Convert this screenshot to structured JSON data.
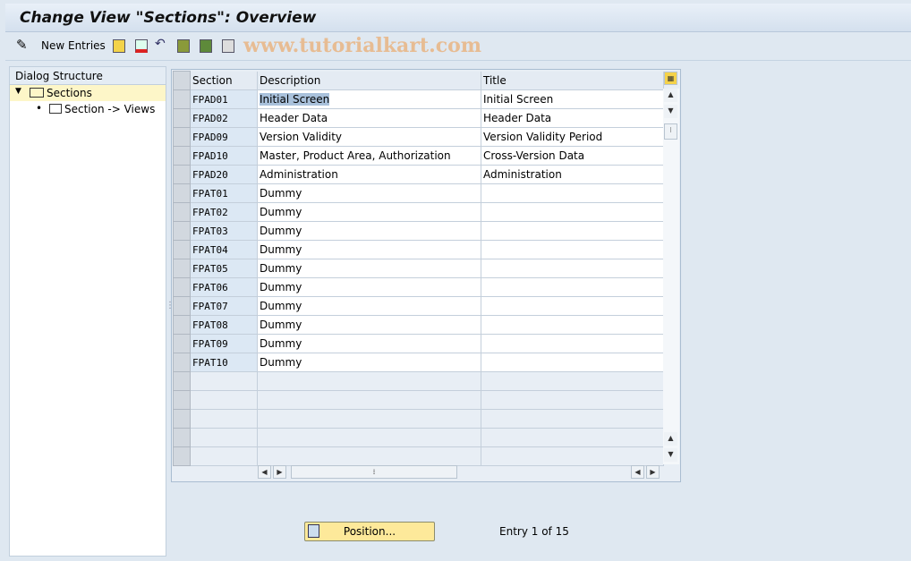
{
  "title": "Change View \"Sections\": Overview",
  "toolbar": {
    "new_entries": "New Entries",
    "watermark": "www.tutorialkart.com"
  },
  "dialog": {
    "header": "Dialog Structure",
    "items": [
      {
        "label": "Sections",
        "selected": true
      },
      {
        "label": "Section -> Views"
      }
    ]
  },
  "table": {
    "columns": [
      "Section",
      "Description",
      "Title"
    ],
    "rows": [
      [
        "FPAD01",
        "Initial Screen",
        "Initial Screen"
      ],
      [
        "FPAD02",
        "Header Data",
        "Header Data"
      ],
      [
        "FPAD09",
        "Version Validity",
        "Version Validity Period"
      ],
      [
        "FPAD10",
        "Master, Product Area, Authorization",
        "Cross-Version Data"
      ],
      [
        "FPAD20",
        "Administration",
        "Administration"
      ],
      [
        "FPAT01",
        "Dummy",
        ""
      ],
      [
        "FPAT02",
        "Dummy",
        ""
      ],
      [
        "FPAT03",
        "Dummy",
        ""
      ],
      [
        "FPAT04",
        "Dummy",
        ""
      ],
      [
        "FPAT05",
        "Dummy",
        ""
      ],
      [
        "FPAT06",
        "Dummy",
        ""
      ],
      [
        "FPAT07",
        "Dummy",
        ""
      ],
      [
        "FPAT08",
        "Dummy",
        ""
      ],
      [
        "FPAT09",
        "Dummy",
        ""
      ],
      [
        "FPAT10",
        "Dummy",
        ""
      ]
    ]
  },
  "footer": {
    "position_button": "Position...",
    "entry": "Entry 1 of 15"
  }
}
